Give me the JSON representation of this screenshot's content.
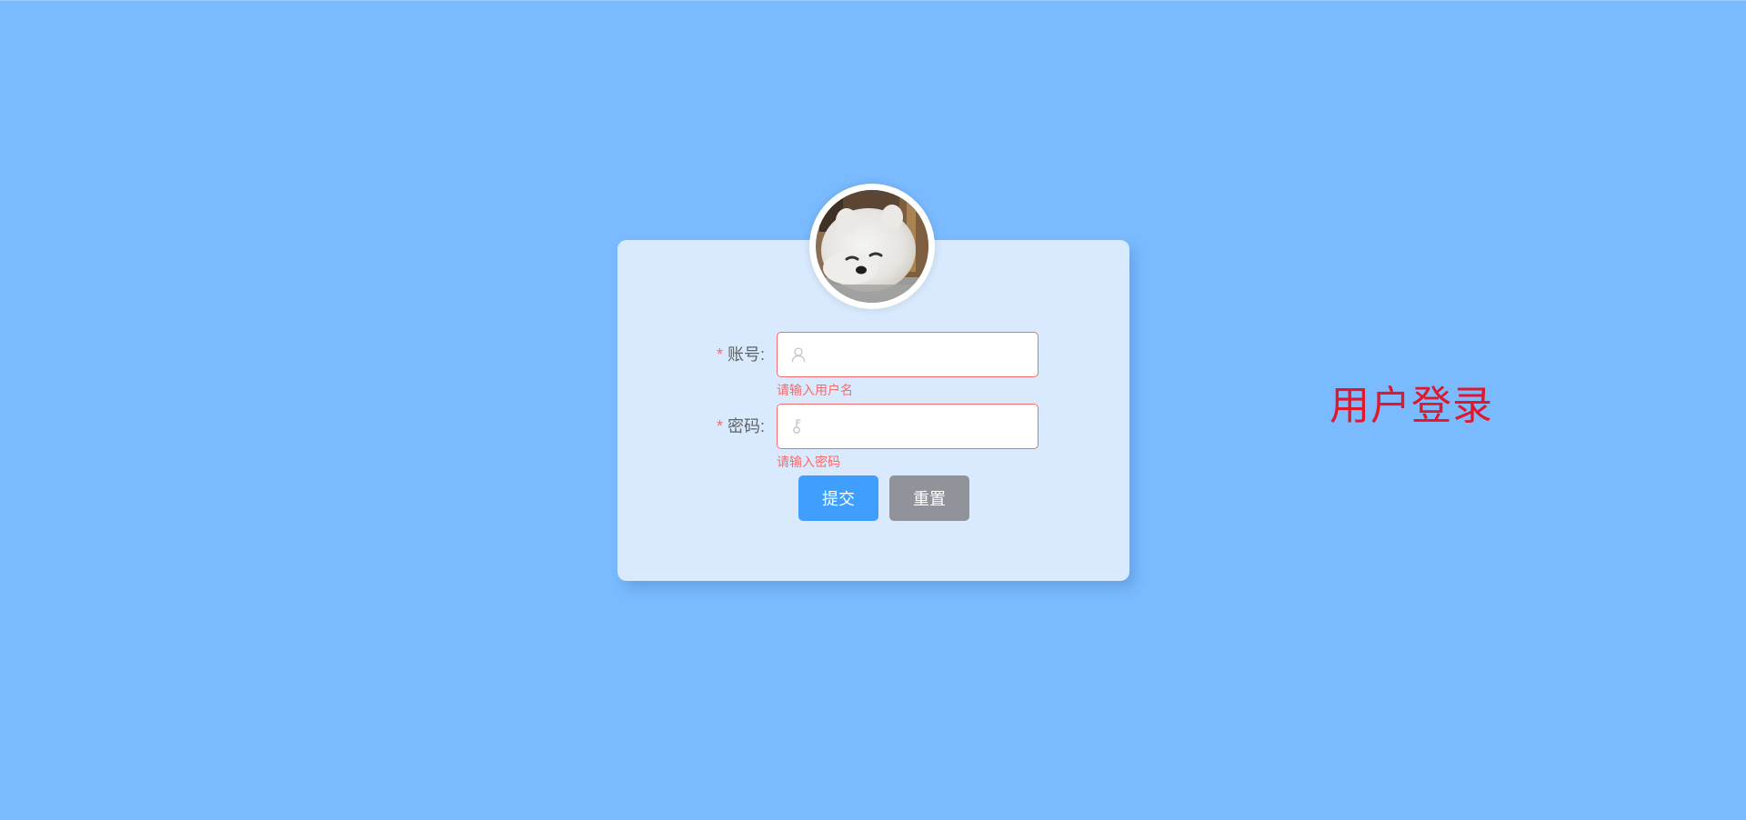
{
  "login_form": {
    "account": {
      "required_mark": "*",
      "label": "账号:",
      "value": "",
      "placeholder": "",
      "icon": "user-icon",
      "error": "请输入用户名"
    },
    "password": {
      "required_mark": "*",
      "label": "密码:",
      "value": "",
      "placeholder": "",
      "icon": "key-icon",
      "error": "请输入密码"
    },
    "buttons": {
      "submit": "提交",
      "reset": "重置"
    }
  },
  "side_title": "用户登录",
  "colors": {
    "background": "#7abbff",
    "card": "#d9eafe",
    "error": "#f56c6c",
    "primary": "#409eff",
    "secondary": "#909399",
    "title": "#e0182c"
  }
}
